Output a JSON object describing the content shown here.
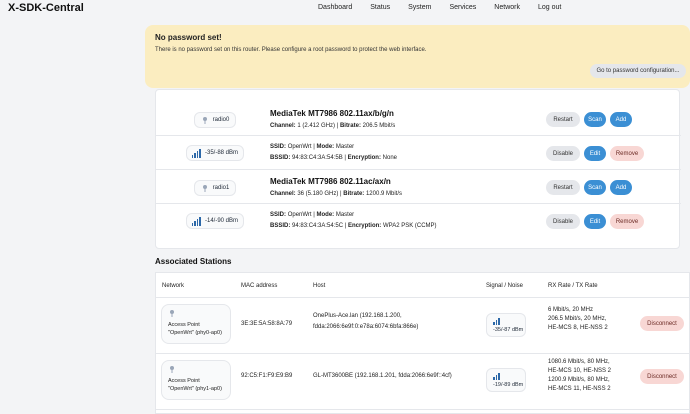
{
  "brand": "X-SDK-Central",
  "nav": [
    "Dashboard",
    "Status",
    "System",
    "Services",
    "Network",
    "Log out"
  ],
  "warning": {
    "title": "No password set!",
    "text": "There is no password set on this router. Please configure a root password to protect the web interface.",
    "button": "Go to password configuration..."
  },
  "radios": [
    {
      "device": "radio0",
      "title": "MediaTek MT7986 802.11ax/b/g/n",
      "channel_label": "Channel:",
      "channel": "1 (2.412 GHz)",
      "bitrate_label": "Bitrate:",
      "bitrate": "206.5 Mbit/s",
      "restart": "Restart",
      "scan": "Scan",
      "add": "Add",
      "iface": {
        "signal": "-35/-88 dBm",
        "ssid_label": "SSID:",
        "ssid": "OpenWrt",
        "mode_label": "Mode:",
        "mode": "Master",
        "bssid_label": "BSSID:",
        "bssid": "94:83:C4:3A:54:5B",
        "enc_label": "Encryption:",
        "enc": "None",
        "disable": "Disable",
        "edit": "Edit",
        "remove": "Remove"
      }
    },
    {
      "device": "radio1",
      "title": "MediaTek MT7986 802.11ac/ax/n",
      "channel_label": "Channel:",
      "channel": "36 (5.180 GHz)",
      "bitrate_label": "Bitrate:",
      "bitrate": "1200.9 Mbit/s",
      "restart": "Restart",
      "scan": "Scan",
      "add": "Add",
      "iface": {
        "signal": "-14/-90 dBm",
        "ssid_label": "SSID:",
        "ssid": "OpenWrt",
        "mode_label": "Mode:",
        "mode": "Master",
        "bssid_label": "BSSID:",
        "bssid": "94:83:C4:3A:54:5C",
        "enc_label": "Encryption:",
        "enc": "WPA2 PSK (CCMP)",
        "disable": "Disable",
        "edit": "Edit",
        "remove": "Remove"
      }
    }
  ],
  "stations": {
    "title": "Associated Stations",
    "headers": [
      "Network",
      "MAC address",
      "Host",
      "Signal / Noise",
      "RX Rate / TX Rate"
    ],
    "rows": [
      {
        "network_l1": "Access Point",
        "network_l2": "\"OpenWrt\" (phy0-ap0)",
        "mac": "3E:3E:5A:58:8A:79",
        "host_l1": "OnePlus-Ace.lan (192.168.1.200,",
        "host_l2": "fdda:2066:6e9f:0:e78a:6074:6bfa:866e)",
        "signal": "-35/-87 dBm",
        "rate": [
          "6 Mbit/s, 20 MHz",
          "206.5 Mbit/s, 20 MHz,",
          "HE-MCS 8, HE-NSS 2"
        ],
        "disconnect": "Disconnect"
      },
      {
        "network_l1": "Access Point",
        "network_l2": "\"OpenWrt\" (phy1-ap0)",
        "mac": "92:C5:F1:F9:E9:B9",
        "host_l1": "GL-MT3600BE (192.168.1.201, fdda:2066:6e9f::4cf)",
        "host_l2": "",
        "signal": "-19/-89 dBm",
        "rate": [
          "1080.6 Mbit/s, 80 MHz,",
          "HE-MCS 10, HE-NSS 2",
          "1200.9 Mbit/s, 80 MHz,",
          "HE-MCS 11, HE-NSS 2"
        ],
        "disconnect": "Disconnect"
      }
    ]
  }
}
